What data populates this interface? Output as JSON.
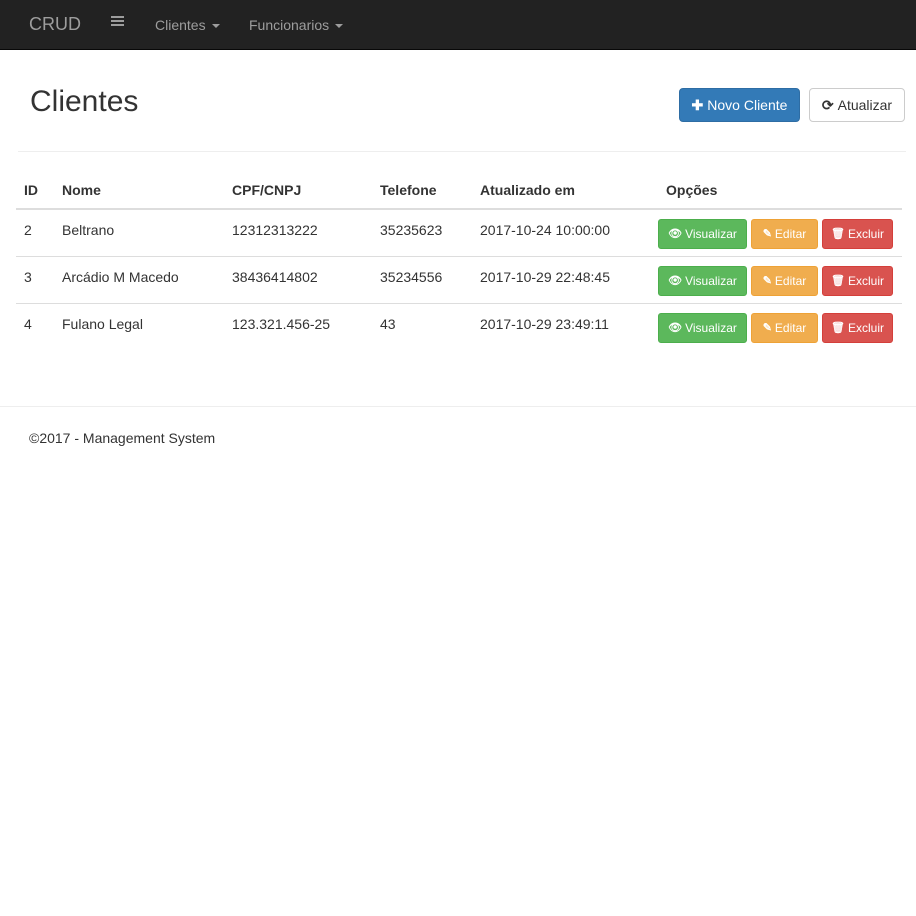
{
  "navbar": {
    "brand": "CRUD",
    "menu_icon": "hamburger-icon",
    "items": [
      {
        "label": "Clientes"
      },
      {
        "label": "Funcionarios"
      }
    ]
  },
  "page": {
    "title": "Clientes",
    "new_button": "Novo Cliente",
    "new_icon": "plus-icon",
    "refresh_button": "Atualizar",
    "refresh_icon": "refresh-icon"
  },
  "table": {
    "headers": {
      "id": "ID",
      "nome": "Nome",
      "doc": "CPF/CNPJ",
      "tel": "Telefone",
      "upd": "Atualizado em",
      "opts": "Opções"
    },
    "rows": [
      {
        "id": "2",
        "nome": "Beltrano",
        "doc": "12312313222",
        "tel": "35235623",
        "upd": "2017-10-24 10:00:00"
      },
      {
        "id": "3",
        "nome": "Arcádio M Macedo",
        "doc": "38436414802",
        "tel": "35234556",
        "upd": "2017-10-29 22:48:45"
      },
      {
        "id": "4",
        "nome": "Fulano Legal",
        "doc": "123.321.456-25",
        "tel": "43",
        "upd": "2017-10-29 23:49:11"
      }
    ],
    "actions": {
      "view": "Visualizar",
      "view_icon": "eye-icon",
      "edit": "Editar",
      "edit_icon": "pencil-icon",
      "delete": "Excluir",
      "delete_icon": "trash-icon"
    }
  },
  "colors": {
    "navbar_bg": "#222222",
    "primary": "#337ab7",
    "success": "#5cb85c",
    "warning": "#f0ad4e",
    "danger": "#d9534f"
  },
  "footer": {
    "text": "©2017 - Management System"
  }
}
